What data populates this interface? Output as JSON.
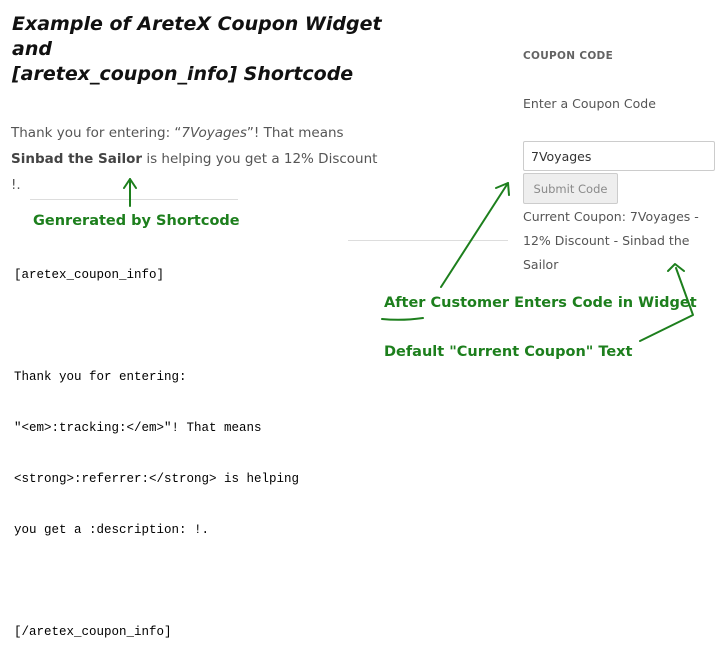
{
  "heading": {
    "line1": "Example of AreteX Coupon Widget and",
    "line2": "[aretex_coupon_info] Shortcode"
  },
  "shortcode_output": {
    "prefix": "Thank you for entering: “",
    "tracking": "7Voyages",
    "middle": "”! That means",
    "referrer": "Sinbad the Sailor",
    "suffix": " is helping you get a 12% Discount !."
  },
  "annotations": {
    "generated_by": "Genrerated by Shortcode",
    "after_customer": "After Customer Enters Code in Widget",
    "default_text": "Default \"Current Coupon\" Text"
  },
  "shortcode_source": {
    "lines": [
      "[aretex_coupon_info]",
      "",
      "Thank you for entering:",
      "\"<em>:tracking:</em>\"! That means",
      "<strong>:referrer:</strong> is helping",
      "you get a :description: !.",
      "",
      "[/aretex_coupon_info]"
    ]
  },
  "widget": {
    "title": "COUPON CODE",
    "label": "Enter a Coupon Code",
    "input_value": "7Voyages",
    "submit_label": "Submit Code",
    "current_coupon": "Current Coupon: 7Voyages - 12% Discount - Sinbad the Sailor"
  },
  "colors": {
    "annotation_green": "#1d7f1d",
    "text_gray": "#555555"
  }
}
